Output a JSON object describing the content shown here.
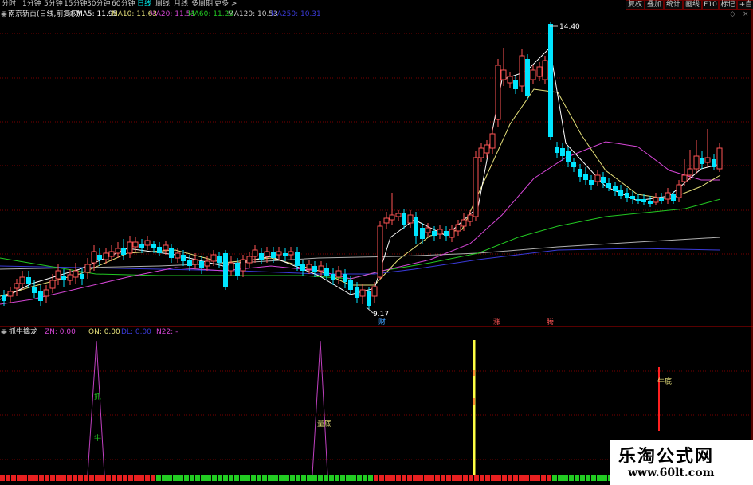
{
  "toolbar": {
    "timeframes": [
      "分时",
      "1分钟",
      "5分钟",
      "15分钟",
      "30分钟",
      "60分钟",
      "日线",
      "周线",
      "月线",
      "多周期",
      "更多 >"
    ],
    "active_timeframe": "日线",
    "right_buttons": [
      "复权",
      "叠加",
      "统计",
      "画线",
      "F10",
      "标记",
      "+自"
    ]
  },
  "info": {
    "stock_name": "南京新百(日线,前复权)",
    "ma5": "MA5: 11.95",
    "ma10": "MA10: 11.63",
    "ma20": "MA20: 11.53",
    "ma60": "MA60: 11.23",
    "ma120": "MA120: 10.53",
    "ma250": "MA250: 10.31"
  },
  "price_chart": {
    "high_label": "14.40",
    "low_label": "9.17",
    "events": [
      {
        "label": "财"
      },
      {
        "label": "涨"
      },
      {
        "label": "腾"
      }
    ],
    "colors": {
      "up": "#ff5555",
      "down": "#00e5ff",
      "ma5": "#ffffff",
      "ma10": "#e6e07a",
      "ma20": "#d646d6",
      "ma60": "#22c822",
      "ma120": "#3a3ad8",
      "ma250": "#b0b0b0"
    }
  },
  "indicator": {
    "name": "抓牛擒龙",
    "zn": "ZN: 0.00",
    "qn": "QN: 0.00",
    "dl": "DL: 0.00",
    "n22": "N22: -",
    "labels": {
      "zhua": "抓",
      "niu": "牛",
      "liangdi": "量底",
      "niudi": "牛底"
    }
  },
  "watermark": {
    "title": "乐淘公式网",
    "url": "www.60lt.com"
  }
}
